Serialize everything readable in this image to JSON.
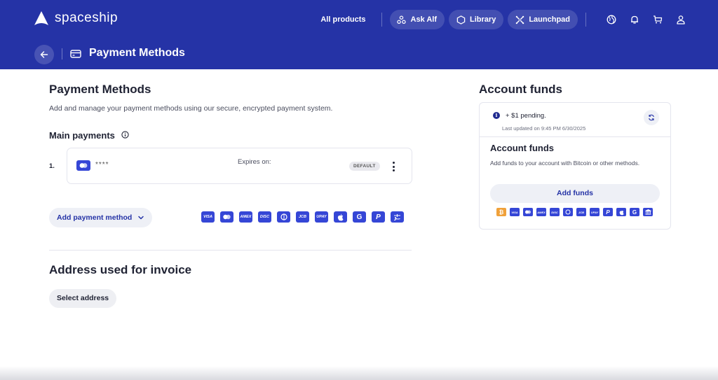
{
  "brand": {
    "name": "spaceship",
    "header_color": "#2533a6",
    "accent": "#3546d6"
  },
  "nav": {
    "all_products": "All products",
    "pills": [
      {
        "label": "Ask Alf",
        "icon": "alf-icon"
      },
      {
        "label": "Library",
        "icon": "hexagon-icon"
      },
      {
        "label": "Launchpad",
        "icon": "launchpad-icon"
      }
    ],
    "icons": [
      "globe-icon",
      "bell-icon",
      "cart-icon",
      "user-icon"
    ]
  },
  "subheader": {
    "title": "Payment Methods",
    "back_icon": "arrow-left-icon",
    "title_icon": "credit-card-icon"
  },
  "payment_methods": {
    "title": "Payment Methods",
    "description": "Add and manage your payment methods using our secure, encrypted payment system.",
    "main_payments": {
      "title": "Main payments",
      "items": [
        {
          "number": "1.",
          "masked": "****",
          "expires_label": "Expires on:",
          "badge": "DEFAULT",
          "icon": "mastercard-icon"
        }
      ]
    },
    "add_button": "Add payment method",
    "supported_logos": [
      "VISA",
      "MC",
      "AMEX",
      "DISC",
      "DC",
      "JCB",
      "UPAY",
      "APPLE",
      "G",
      "P",
      "ALIPAY"
    ]
  },
  "invoice": {
    "title": "Address used for invoice",
    "button": "Select address"
  },
  "account_funds": {
    "title": "Account funds",
    "pending": "+ $1 pending.",
    "last_updated": "Last updated on 9:45 PM 6/30/2025",
    "subtitle": "Account funds",
    "description": "Add funds to your account with Bitcoin or other methods.",
    "add_button": "Add funds",
    "supported_logos": [
      "BTC",
      "VISA",
      "MC",
      "AMEX",
      "DISC",
      "DC",
      "JCB",
      "UPAY",
      "P",
      "APPLE",
      "G",
      "BANK"
    ]
  }
}
